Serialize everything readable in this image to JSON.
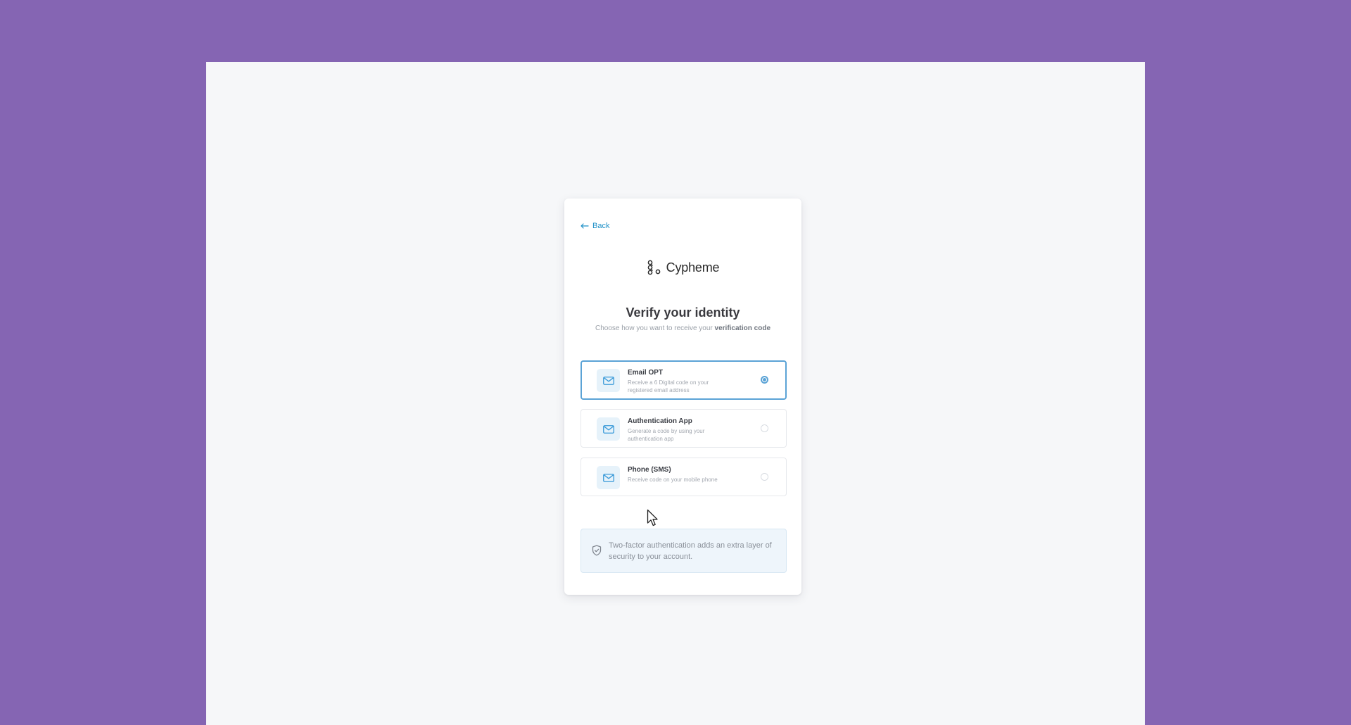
{
  "card": {
    "back_label": "Back",
    "logo_text": "Cypheme",
    "title": "Verify your identity",
    "subtitle_prefix": "Choose how you want to receive your ",
    "subtitle_emphasis": "verification code"
  },
  "options": [
    {
      "title": "Email OPT",
      "description": "Receive a 6 Digital code on your registered email address",
      "icon": "mail-icon",
      "selected": true
    },
    {
      "title": "Authentication App",
      "description": "Generate a code by using your authentication app",
      "icon": "mail-icon",
      "selected": false
    },
    {
      "title": "Phone (SMS)",
      "description": "Receive code on your mobile phone",
      "icon": "mail-icon",
      "selected": false
    }
  ],
  "info": {
    "icon": "shield-check-icon",
    "text": "Two-factor authentication adds an extra layer of security to your account."
  },
  "colors": {
    "outer_background": "#8565b3",
    "page_background": "#f6f7f9",
    "accent": "#5ba3d6",
    "link": "#1e90c7"
  }
}
